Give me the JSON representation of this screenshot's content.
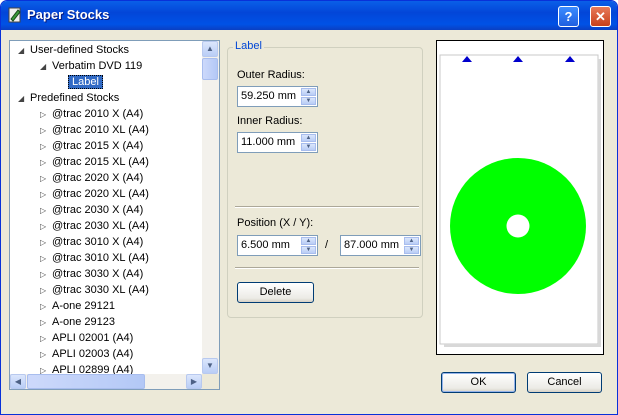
{
  "window": {
    "title": "Paper Stocks",
    "help_label": "?",
    "close_label": "✕"
  },
  "tree": {
    "user_root": "User-defined Stocks",
    "user_stock": "Verbatim DVD 119",
    "user_label": "Label",
    "predef_root": "Predefined Stocks",
    "items": [
      "@trac 2010 X (A4)",
      "@trac 2010 XL (A4)",
      "@trac 2015 X (A4)",
      "@trac 2015 XL (A4)",
      "@trac 2020 X (A4)",
      "@trac 2020 XL (A4)",
      "@trac 2030 X (A4)",
      "@trac 2030 XL (A4)",
      "@trac 3010 X (A4)",
      "@trac 3010 XL (A4)",
      "@trac 3030 X (A4)",
      "@trac 3030 XL (A4)",
      "A-one 29121",
      "A-one 29123",
      "APLI 02001 (A4)",
      "APLI 02003 (A4)",
      "APLI 02899 (A4)"
    ]
  },
  "label_group": {
    "title": "Label",
    "outer_radius_label": "Outer Radius:",
    "outer_radius_value": "59.250 mm",
    "inner_radius_label": "Inner Radius:",
    "inner_radius_value": "11.000 mm",
    "position_label": "Position (X / Y):",
    "position_x": "6.500 mm",
    "position_sep": "/",
    "position_y": "87.000 mm",
    "delete_label": "Delete"
  },
  "preview": {
    "disc_color": "#00ff00",
    "marker_color": "#0000cc"
  },
  "buttons": {
    "ok": "OK",
    "cancel": "Cancel"
  }
}
